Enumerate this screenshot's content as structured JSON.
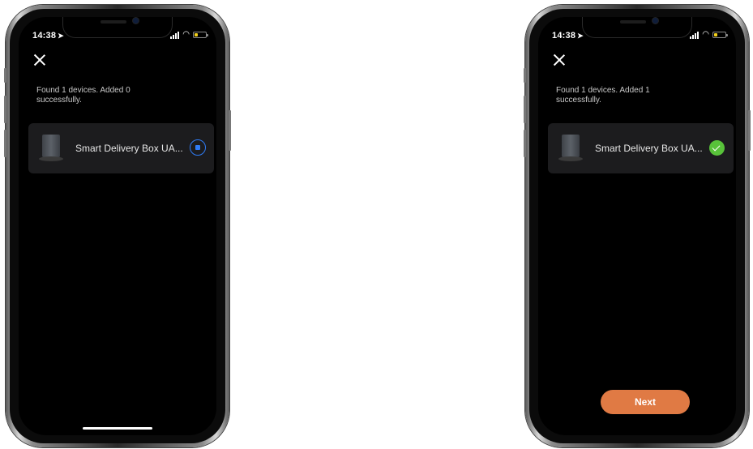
{
  "screens": [
    {
      "status": {
        "time": "14:38",
        "location_arrow": "➤"
      },
      "message": "Found 1 devices. Added 0 successfully.",
      "device": {
        "name": "Smart Delivery Box UA...",
        "state_icon": "stop-spinner-icon",
        "accent": "#2f7cf6"
      }
    },
    {
      "status": {
        "time": "14:38",
        "location_arrow": "➤"
      },
      "message": "Found 1 devices. Added 1 successfully.",
      "device": {
        "name": "Smart Delivery Box UA...",
        "state_icon": "check-circle-icon",
        "accent": "#58c23a"
      },
      "next_label": "Next",
      "next_color": "#e07a44"
    }
  ]
}
